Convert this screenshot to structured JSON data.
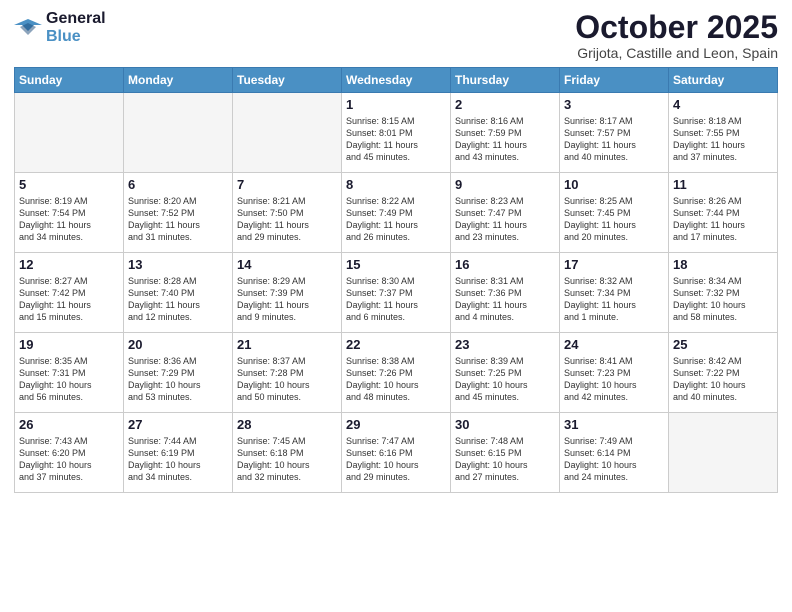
{
  "header": {
    "logo_line1": "General",
    "logo_line2": "Blue",
    "month_title": "October 2025",
    "subtitle": "Grijota, Castille and Leon, Spain"
  },
  "weekdays": [
    "Sunday",
    "Monday",
    "Tuesday",
    "Wednesday",
    "Thursday",
    "Friday",
    "Saturday"
  ],
  "weeks": [
    [
      {
        "day": "",
        "info": ""
      },
      {
        "day": "",
        "info": ""
      },
      {
        "day": "",
        "info": ""
      },
      {
        "day": "1",
        "info": "Sunrise: 8:15 AM\nSunset: 8:01 PM\nDaylight: 11 hours\nand 45 minutes."
      },
      {
        "day": "2",
        "info": "Sunrise: 8:16 AM\nSunset: 7:59 PM\nDaylight: 11 hours\nand 43 minutes."
      },
      {
        "day": "3",
        "info": "Sunrise: 8:17 AM\nSunset: 7:57 PM\nDaylight: 11 hours\nand 40 minutes."
      },
      {
        "day": "4",
        "info": "Sunrise: 8:18 AM\nSunset: 7:55 PM\nDaylight: 11 hours\nand 37 minutes."
      }
    ],
    [
      {
        "day": "5",
        "info": "Sunrise: 8:19 AM\nSunset: 7:54 PM\nDaylight: 11 hours\nand 34 minutes."
      },
      {
        "day": "6",
        "info": "Sunrise: 8:20 AM\nSunset: 7:52 PM\nDaylight: 11 hours\nand 31 minutes."
      },
      {
        "day": "7",
        "info": "Sunrise: 8:21 AM\nSunset: 7:50 PM\nDaylight: 11 hours\nand 29 minutes."
      },
      {
        "day": "8",
        "info": "Sunrise: 8:22 AM\nSunset: 7:49 PM\nDaylight: 11 hours\nand 26 minutes."
      },
      {
        "day": "9",
        "info": "Sunrise: 8:23 AM\nSunset: 7:47 PM\nDaylight: 11 hours\nand 23 minutes."
      },
      {
        "day": "10",
        "info": "Sunrise: 8:25 AM\nSunset: 7:45 PM\nDaylight: 11 hours\nand 20 minutes."
      },
      {
        "day": "11",
        "info": "Sunrise: 8:26 AM\nSunset: 7:44 PM\nDaylight: 11 hours\nand 17 minutes."
      }
    ],
    [
      {
        "day": "12",
        "info": "Sunrise: 8:27 AM\nSunset: 7:42 PM\nDaylight: 11 hours\nand 15 minutes."
      },
      {
        "day": "13",
        "info": "Sunrise: 8:28 AM\nSunset: 7:40 PM\nDaylight: 11 hours\nand 12 minutes."
      },
      {
        "day": "14",
        "info": "Sunrise: 8:29 AM\nSunset: 7:39 PM\nDaylight: 11 hours\nand 9 minutes."
      },
      {
        "day": "15",
        "info": "Sunrise: 8:30 AM\nSunset: 7:37 PM\nDaylight: 11 hours\nand 6 minutes."
      },
      {
        "day": "16",
        "info": "Sunrise: 8:31 AM\nSunset: 7:36 PM\nDaylight: 11 hours\nand 4 minutes."
      },
      {
        "day": "17",
        "info": "Sunrise: 8:32 AM\nSunset: 7:34 PM\nDaylight: 11 hours\nand 1 minute."
      },
      {
        "day": "18",
        "info": "Sunrise: 8:34 AM\nSunset: 7:32 PM\nDaylight: 10 hours\nand 58 minutes."
      }
    ],
    [
      {
        "day": "19",
        "info": "Sunrise: 8:35 AM\nSunset: 7:31 PM\nDaylight: 10 hours\nand 56 minutes."
      },
      {
        "day": "20",
        "info": "Sunrise: 8:36 AM\nSunset: 7:29 PM\nDaylight: 10 hours\nand 53 minutes."
      },
      {
        "day": "21",
        "info": "Sunrise: 8:37 AM\nSunset: 7:28 PM\nDaylight: 10 hours\nand 50 minutes."
      },
      {
        "day": "22",
        "info": "Sunrise: 8:38 AM\nSunset: 7:26 PM\nDaylight: 10 hours\nand 48 minutes."
      },
      {
        "day": "23",
        "info": "Sunrise: 8:39 AM\nSunset: 7:25 PM\nDaylight: 10 hours\nand 45 minutes."
      },
      {
        "day": "24",
        "info": "Sunrise: 8:41 AM\nSunset: 7:23 PM\nDaylight: 10 hours\nand 42 minutes."
      },
      {
        "day": "25",
        "info": "Sunrise: 8:42 AM\nSunset: 7:22 PM\nDaylight: 10 hours\nand 40 minutes."
      }
    ],
    [
      {
        "day": "26",
        "info": "Sunrise: 7:43 AM\nSunset: 6:20 PM\nDaylight: 10 hours\nand 37 minutes."
      },
      {
        "day": "27",
        "info": "Sunrise: 7:44 AM\nSunset: 6:19 PM\nDaylight: 10 hours\nand 34 minutes."
      },
      {
        "day": "28",
        "info": "Sunrise: 7:45 AM\nSunset: 6:18 PM\nDaylight: 10 hours\nand 32 minutes."
      },
      {
        "day": "29",
        "info": "Sunrise: 7:47 AM\nSunset: 6:16 PM\nDaylight: 10 hours\nand 29 minutes."
      },
      {
        "day": "30",
        "info": "Sunrise: 7:48 AM\nSunset: 6:15 PM\nDaylight: 10 hours\nand 27 minutes."
      },
      {
        "day": "31",
        "info": "Sunrise: 7:49 AM\nSunset: 6:14 PM\nDaylight: 10 hours\nand 24 minutes."
      },
      {
        "day": "",
        "info": ""
      }
    ]
  ],
  "accent_color": "#4a90c4"
}
